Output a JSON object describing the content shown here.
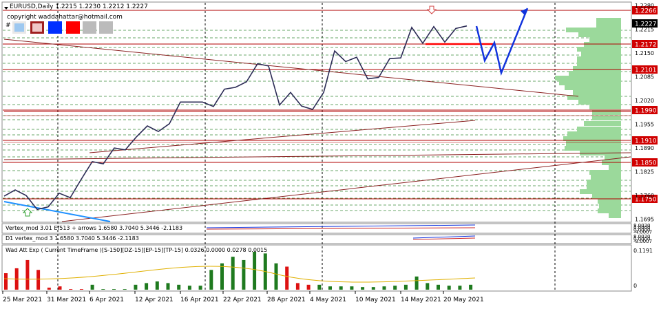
{
  "header": {
    "symbol_line": "EURUSD,Daily  1.2215 1.2230 1.2212 1.2227",
    "copyright": "copyright waddahattar@hotmail.com",
    "hash_mark": "#"
  },
  "main_panel": {
    "price_labels": [
      {
        "value": "1.2266",
        "style": "red"
      },
      {
        "value": "1.2227",
        "style": "black"
      },
      {
        "value": "1.2172",
        "style": "red"
      },
      {
        "value": "1.2101",
        "style": "red"
      },
      {
        "value": "1.1990",
        "style": "red"
      },
      {
        "value": "1.1910",
        "style": "red"
      },
      {
        "value": "1.1850",
        "style": "red"
      },
      {
        "value": "1.1750",
        "style": "red"
      }
    ],
    "axis_ticks": [
      "1.2280",
      "1.2215",
      "1.2150",
      "1.2085",
      "1.2020",
      "1.1955",
      "1.1890",
      "1.1825",
      "1.1760",
      "1.1695"
    ]
  },
  "vertex_panel_1": {
    "label": "Vertex_mod 3.01 Ef513 + arrows 1.6580 3.7040 5.3446 -2.1183",
    "axis_ticks": [
      "8.0020",
      "4.0000",
      "0.0000",
      "-4.0007"
    ]
  },
  "vertex_panel_2": {
    "label": "D1 vertex_mod 3 1.6580 3.7040 5.3446 -2.1183",
    "axis_ticks": [
      "8.0020",
      "0.0000",
      "-8.0007"
    ]
  },
  "wad_panel": {
    "label": "Wad Att Exp ( Current TimeFrame )[S-150][DZ-15][EP-15][TP-15] 0.0326 0.0000 0.0278 0.0015",
    "axis_ticks": [
      "0.1191",
      "0"
    ]
  },
  "time_axis": [
    "25 Mar 2021",
    "31 Mar 2021",
    "6 Apr 2021",
    "12 Apr 2021",
    "16 Apr 2021",
    "22 Apr 2021",
    "28 Apr 2021",
    "4 May 2021",
    "10 May 2021",
    "14 May 2021",
    "20 May 2021"
  ],
  "colors": {
    "price_line": "#2b2b55",
    "projection": "#1133dd",
    "level_line": "#b00000",
    "volume_profile": "#9bd99b",
    "bull_bar": "#1f7a1f",
    "bear_bar": "#dd1111",
    "axis_label_red": "#d00000"
  },
  "icons": [
    "down-arrow-icon",
    "up-arrow-icon",
    "dropdown-triangle-icon"
  ],
  "chart_data": [
    {
      "type": "line",
      "series": [
        {
          "values": [
            1.1764,
            1.1781,
            1.1766,
            1.1728,
            1.1735,
            1.1772,
            1.176,
            1.181,
            1.1858,
            1.1852,
            1.1895,
            1.189,
            1.1925,
            1.1955,
            1.194,
            1.1961,
            1.202,
            1.202,
            1.202,
            1.2008,
            1.2055,
            1.206,
            1.2075,
            1.2124,
            1.2118,
            1.2012,
            1.2046,
            1.2009,
            1.2,
            1.2046,
            1.2159,
            1.213,
            1.2142,
            1.2083,
            1.2087,
            1.2138,
            1.214,
            1.2223,
            1.218,
            1.2225,
            1.2183,
            1.222,
            1.2227
          ]
        }
      ],
      "ylim": [
        1.1695,
        1.229
      ]
    },
    {
      "type": "bar",
      "series": [
        {
          "name": "Wad Att Exp",
          "values": [
            0.05,
            0.065,
            0.09,
            0.06,
            0.006,
            0.01,
            0.0,
            0.0,
            0.015,
            0.0,
            0.0,
            0.0,
            0.015,
            0.02,
            0.025,
            0.02,
            0.015,
            0.012,
            0.012,
            0.06,
            0.08,
            0.1,
            0.09,
            0.115,
            0.11,
            0.08,
            0.07,
            0.02,
            0.015,
            0.015,
            0.01,
            0.01,
            0.01,
            0.008,
            0.008,
            0.01,
            0.012,
            0.015,
            0.04,
            0.02,
            0.015,
            0.012,
            0.012,
            0.015
          ]
        }
      ],
      "ylim": [
        0,
        0.1191
      ]
    }
  ]
}
